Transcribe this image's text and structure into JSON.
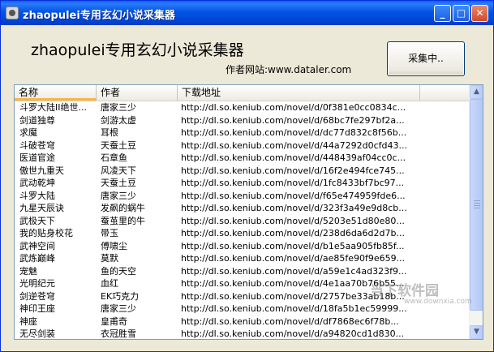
{
  "window": {
    "title": "zhaopulei专用玄幻小说采集器",
    "controls": {
      "minimize": "_",
      "maximize": "□",
      "close": "✕"
    }
  },
  "header": {
    "heading": "zhaopulei专用玄幻小说采集器",
    "site": "作者网站:www.dataler.com",
    "collect_button": "采集中.."
  },
  "table": {
    "columns": [
      "名称",
      "作者",
      "下载地址"
    ],
    "rows": [
      {
        "name": "斗罗大陆II绝世...",
        "author": "唐家三少",
        "url": "http://dl.so.keniub.com/novel/d/0f381e0cc0834c..."
      },
      {
        "name": "剑道独尊",
        "author": "剑游太虚",
        "url": "http://dl.so.keniub.com/novel/d/68bc7fe297bf2a..."
      },
      {
        "name": "求魔",
        "author": "耳根",
        "url": "http://dl.so.keniub.com/novel/d/dc77d832c8f56b..."
      },
      {
        "name": "斗破苍穹",
        "author": "天蚕土豆",
        "url": "http://dl.so.keniub.com/novel/d/44a7292d0cfd43..."
      },
      {
        "name": "医道官途",
        "author": "石章鱼",
        "url": "http://dl.so.keniub.com/novel/d/448439af04cc0c..."
      },
      {
        "name": "傲世九重天",
        "author": "风凌天下",
        "url": "http://dl.so.keniub.com/novel/d/16f2e494fce745..."
      },
      {
        "name": "武动乾坤",
        "author": "天蚕土豆",
        "url": "http://dl.so.keniub.com/novel/d/1fc8433bf7bc97..."
      },
      {
        "name": "斗罗大陆",
        "author": "唐家三少",
        "url": "http://dl.so.keniub.com/novel/d/f65e474959fde6..."
      },
      {
        "name": "九星天辰诀",
        "author": "发飙的蜗牛",
        "url": "http://dl.so.keniub.com/novel/d/323f3a49e9d8cb..."
      },
      {
        "name": "武极天下",
        "author": "蚕茧里的牛",
        "url": "http://dl.so.keniub.com/novel/d/5203e51d80e80..."
      },
      {
        "name": "我的贴身校花",
        "author": "带玉",
        "url": "http://dl.so.keniub.com/novel/d/238d6da6d2d7b..."
      },
      {
        "name": "武神空间",
        "author": "傅啸尘",
        "url": "http://dl.so.keniub.com/novel/d/b1e5aa905fb85f..."
      },
      {
        "name": "武炼巅峰",
        "author": "莫默",
        "url": "http://dl.so.keniub.com/novel/d/ae85fe90f9e659..."
      },
      {
        "name": "宠魅",
        "author": "鱼的天空",
        "url": "http://dl.so.keniub.com/novel/d/a59e1c4ad323f9..."
      },
      {
        "name": "光明纪元",
        "author": "血红",
        "url": "http://dl.so.keniub.com/novel/d/4e1aa70b76b55..."
      },
      {
        "name": "剑逆苍穹",
        "author": "EK巧克力",
        "url": "http://dl.so.keniub.com/novel/d/2757be33ab18b..."
      },
      {
        "name": "神印王座",
        "author": "唐家三少",
        "url": "http://dl.so.keniub.com/novel/d/18fa5b1ec59999..."
      },
      {
        "name": "神座",
        "author": "皇甫奇",
        "url": "http://dl.so.keniub.com/novel/d/df7868ec6f78b..."
      },
      {
        "name": "无尽剑装",
        "author": "衣冠胜雪",
        "url": "http://dl.so.keniub.com/novel/d/a94820cd1d830..."
      }
    ]
  },
  "watermark": {
    "text": "当下软件园",
    "sub": "www.downxia.com"
  },
  "colors": {
    "titlebar": "#0055e5",
    "face": "#ece9d8",
    "list_border": "#7f9db9",
    "sort_indicator": "#f7b54a"
  },
  "icons": [
    "app-icon",
    "minimize-icon",
    "maximize-icon",
    "close-icon",
    "scroll-up-icon",
    "scroll-down-icon"
  ]
}
